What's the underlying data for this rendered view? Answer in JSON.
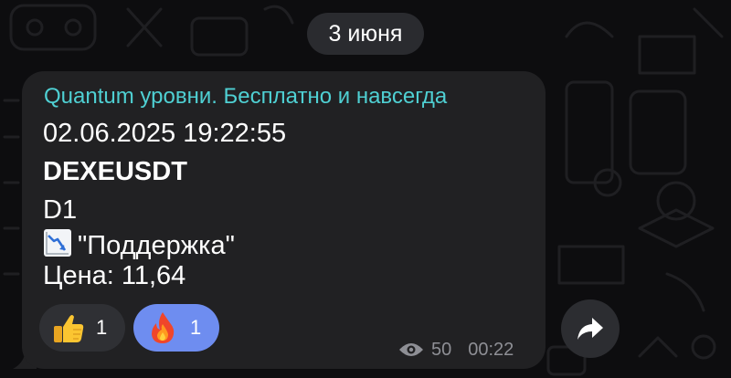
{
  "date_divider": {
    "label": "3 июня"
  },
  "message": {
    "author": "Quantum уровни. Бесплатно и навсегда",
    "datetime": "02.06.2025 19:22:55",
    "symbol": "DEXEUSDT",
    "timeframe": "D1",
    "signal_icon": "chart-decreasing-icon",
    "signal": "\"Поддержка\"",
    "price": "Цена: 11,64",
    "reactions": [
      {
        "icon": "thumbs-up-icon",
        "count": "1",
        "selected": false
      },
      {
        "icon": "fire-icon",
        "count": "1",
        "selected": true
      }
    ],
    "views": "50",
    "time": "00:22"
  },
  "share_button": {
    "icon": "share-arrow-icon"
  },
  "colors": {
    "author_accent": "#4fd0d3",
    "selected_reaction": "#6e8df0",
    "bubble": "#212123",
    "background": "#0d0d0f"
  }
}
